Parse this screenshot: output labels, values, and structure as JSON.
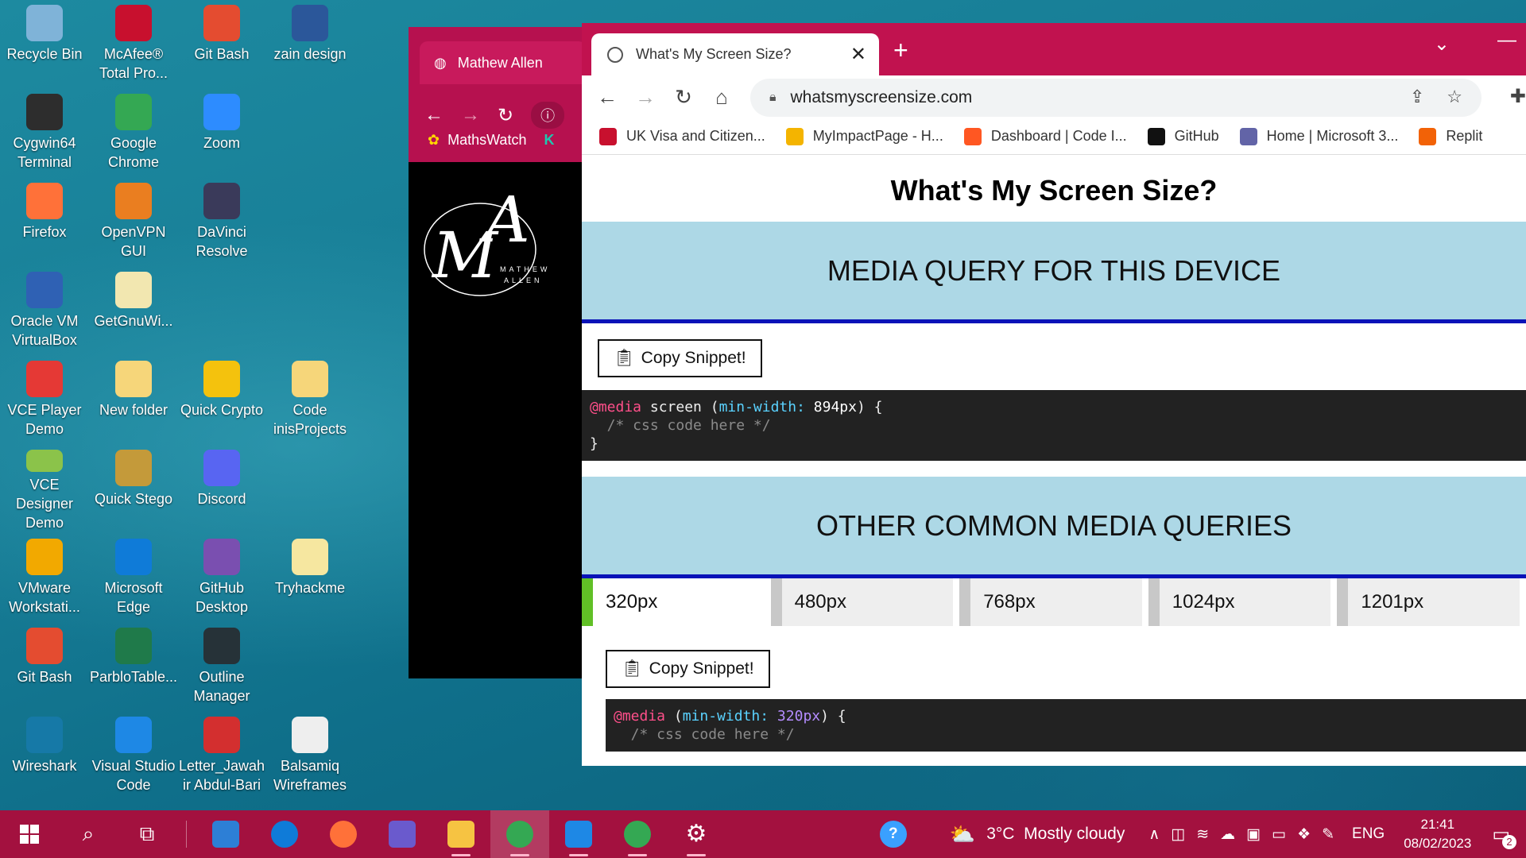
{
  "desktop": {
    "icons": [
      {
        "label": "Recycle Bin",
        "icon": "recycle-bin-icon",
        "color": "#7fb3d8"
      },
      {
        "label": "McAfee® Total Pro...",
        "icon": "mcafee-icon",
        "color": "#c8102e"
      },
      {
        "label": "Git Bash",
        "icon": "git-bash-icon",
        "color": "#e44c30"
      },
      {
        "label": "zain design",
        "icon": "word-doc-icon",
        "color": "#2b579a"
      },
      {
        "label": "Cygwin64 Terminal",
        "icon": "cygwin-icon",
        "color": "#2d2d2d"
      },
      {
        "label": "Google Chrome",
        "icon": "chrome-icon",
        "color": "#34a853"
      },
      {
        "label": "Zoom",
        "icon": "zoom-icon",
        "color": "#2d8cff"
      },
      {
        "label": "Firefox",
        "icon": "firefox-icon",
        "color": "#ff7139"
      },
      {
        "label": "OpenVPN GUI",
        "icon": "openvpn-icon",
        "color": "#ea7e20"
      },
      {
        "label": "DaVinci Resolve",
        "icon": "davinci-icon",
        "color": "#3a3a5a"
      },
      {
        "label": "Oracle VM VirtualBox",
        "icon": "virtualbox-icon",
        "color": "#2f61b4"
      },
      {
        "label": "GetGnuWi...",
        "icon": "file-icon",
        "color": "#f2e7b0"
      },
      {
        "label": "VCE Player Demo",
        "icon": "vce-player-icon",
        "color": "#e53935"
      },
      {
        "label": "New folder",
        "icon": "folder-icon",
        "color": "#f6d67a"
      },
      {
        "label": "Quick Crypto",
        "icon": "key-icon",
        "color": "#f4c20d"
      },
      {
        "label": "Code inisProjects",
        "icon": "folder-icon",
        "color": "#f6d67a"
      },
      {
        "label": "VCE Designer Demo",
        "icon": "vce-designer-icon",
        "color": "#8bc34a"
      },
      {
        "label": "Quick Stego",
        "icon": "stego-icon",
        "color": "#c49a3a"
      },
      {
        "label": "Discord",
        "icon": "discord-icon",
        "color": "#5865f2"
      },
      {
        "label": "VMware Workstati...",
        "icon": "vmware-icon",
        "color": "#f2a900"
      },
      {
        "label": "Microsoft Edge",
        "icon": "edge-icon",
        "color": "#0f7bd8"
      },
      {
        "label": "GitHub Desktop",
        "icon": "github-desktop-icon",
        "color": "#7a4fb0"
      },
      {
        "label": "Tryhackme",
        "icon": "file-icon",
        "color": "#f6e7a0"
      },
      {
        "label": "Git Bash",
        "icon": "git-bash-icon",
        "color": "#e44c30"
      },
      {
        "label": "ParbloTable...",
        "icon": "parblo-icon",
        "color": "#1f7a4a"
      },
      {
        "label": "Outline Manager",
        "icon": "outline-icon",
        "color": "#263238"
      },
      {
        "label": "Wireshark",
        "icon": "wireshark-icon",
        "color": "#1679a7"
      },
      {
        "label": "Visual Studio Code",
        "icon": "vscode-icon",
        "color": "#1e88e5"
      },
      {
        "label": "Letter_Jawahir Abdul-Bari",
        "icon": "pdf-icon",
        "color": "#d32f2f"
      },
      {
        "label": "Balsamiq Wireframes",
        "icon": "balsamiq-icon",
        "color": "#eeeeee"
      }
    ]
  },
  "bg_browser": {
    "tab_title": "Mathew Allen",
    "bookmark": "MathsWatch",
    "logo_text": "MATHEW ALLEN",
    "brand_color": "#b6114f"
  },
  "browser": {
    "tab_title": "What's My Screen Size?",
    "url": "whatsmyscreensize.com",
    "bookmarks": [
      {
        "label": "UK Visa and Citizen...",
        "color": "#c8102e"
      },
      {
        "label": "MyImpactPage - H...",
        "color": "#f4b400"
      },
      {
        "label": "Dashboard | Code I...",
        "color": "#ff5722"
      },
      {
        "label": "GitHub",
        "color": "#111111"
      },
      {
        "label": "Home | Microsoft 3...",
        "color": "#6264a7"
      },
      {
        "label": "Replit",
        "color": "#f26207"
      }
    ],
    "accent_color": "#c1124f"
  },
  "page": {
    "title": "What's My Screen Size?",
    "section1_heading": "MEDIA QUERY FOR THIS DEVICE",
    "copy_label": "Copy Snippet!",
    "snippet1": {
      "at": "@media",
      "line1_mid": " screen (",
      "prop": "min-width:",
      "value": " 894px",
      "line1_end": ") {",
      "comment": "  /* css code here */",
      "close": "}"
    },
    "section2_heading": "OTHER COMMON MEDIA QUERIES",
    "breakpoints": [
      "320px",
      "480px",
      "768px",
      "1024px",
      "1201px"
    ],
    "active_breakpoint_color": "#61c026",
    "snippet2": {
      "at": "@media",
      "line1_mid": " (",
      "prop": "min-width:",
      "value": " 320px",
      "line1_end": ") {",
      "comment": "  /* css code here */"
    }
  },
  "taskbar": {
    "apps": [
      {
        "name": "mail-icon",
        "color": "#2d7fd6"
      },
      {
        "name": "edge-icon",
        "color": "#0f7bd8"
      },
      {
        "name": "firefox-icon",
        "color": "#ff7139"
      },
      {
        "name": "power-automate-icon",
        "color": "#6a5acd"
      },
      {
        "name": "file-explorer-icon",
        "color": "#f6c342"
      },
      {
        "name": "chrome-profile-icon",
        "color": "#34a853"
      },
      {
        "name": "vscode-icon",
        "color": "#1e88e5"
      },
      {
        "name": "chrome-icon",
        "color": "#34a853"
      },
      {
        "name": "settings-icon",
        "color": "#ffffff"
      }
    ],
    "weather": "3°C  Mostly cloudy",
    "language": "ENG",
    "time": "21:41",
    "date": "08/02/2023",
    "notification_count": "2"
  }
}
